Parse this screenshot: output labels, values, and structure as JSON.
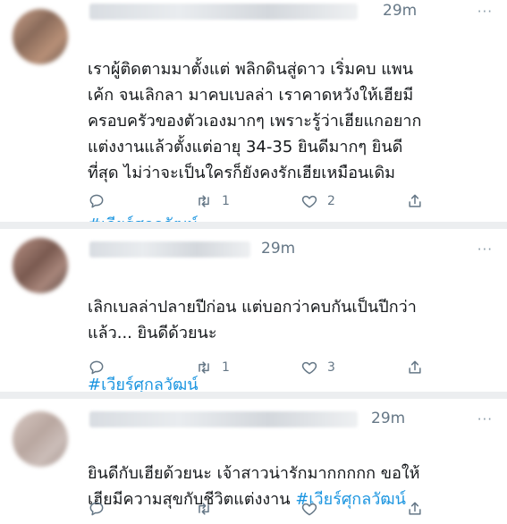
{
  "tweets": [
    {
      "time": "29m",
      "more": "···",
      "text": "เราผู้ติดตามมาตั้งแต่ พลิกดินสู่ดาว เริ่มคบ แพน\nเค้ก จนเลิกลา มาคบเบลล่า เราคาดหวังให้เฮียมี\nครอบครัวของตัวเองมากๆ เพราะรู้ว่าเฮียแกอยาก\nแต่งงานแล้วตั้งแต่อายุ 34-35  ยินดีมากๆ ยินดี\nที่สุด ไม่ว่าจะเป็นใครก็ยังคงรักเฮียเหมือนเดิม",
      "hashtag": "#เวียร์ศุกลวัฒน์",
      "retweets": "1",
      "likes": "2"
    },
    {
      "time": "29m",
      "more": "···",
      "text": "เลิกเบลล่าปลายปีก่อน แต่บอกว่าคบกันเป็นปีกว่า\nแล้ว... ยินดีด้วยนะ",
      "hashtag": "#เวียร์ศุกลวัฒน์",
      "retweets": "1",
      "likes": "3"
    },
    {
      "time": "29m",
      "more": "···",
      "text": "ยินดีกับเฮียด้วยนะ เจ้าสาวน่ารักมากกกกก ขอให้\nเฮียมีความสุขกับชีวิตแต่งงาน ",
      "hashtag": "#เวียร์ศุกลวัฒน์",
      "retweets": "",
      "likes": ""
    }
  ],
  "icons": {
    "reply": "reply-icon",
    "retweet": "retweet-icon",
    "like": "heart-icon",
    "share": "share-icon"
  },
  "colors": {
    "hashtag": "#1b95e0",
    "meta": "#657786"
  }
}
